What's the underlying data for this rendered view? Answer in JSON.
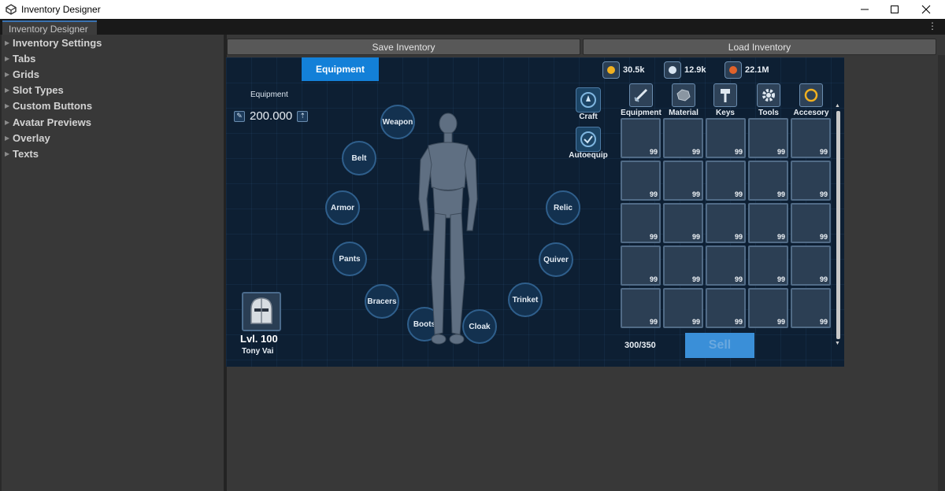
{
  "window": {
    "title": "Inventory Designer"
  },
  "editor": {
    "tab_label": "Inventory Designer",
    "menu_glyph": "⋮",
    "tree_items": [
      "Inventory Settings",
      "Tabs",
      "Grids",
      "Slot Types",
      "Custom Buttons",
      "Avatar Previews",
      "Overlay",
      "Texts"
    ],
    "save_label": "Save Inventory",
    "load_label": "Load Inventory"
  },
  "game": {
    "active_tab": "Equipment",
    "equipment_label": "Equipment",
    "weight_value": "200.000",
    "slots": {
      "weapon": "Weapon",
      "belt": "Belt",
      "armor": "Armor",
      "pants": "Pants",
      "bracers": "Bracers",
      "boots": "Boots",
      "cloak": "Cloak",
      "trinket": "Trinket",
      "quiver": "Quiver",
      "relic": "Relic"
    },
    "player": {
      "level": "Lvl. 100",
      "name": "Tony Vai"
    },
    "craft_label": "Craft",
    "autoequip_label": "Autoequip",
    "currencies": [
      {
        "amount": "30.5k",
        "color": "#f0b020"
      },
      {
        "amount": "12.9k",
        "color": "#d8e4f0"
      },
      {
        "amount": "22.1M",
        "color": "#e0622a"
      }
    ],
    "categories": [
      "Equipment",
      "Material",
      "Keys",
      "Tools",
      "Accesory"
    ],
    "cell_quantity": "99",
    "capacity": "300/350",
    "sell_label": "Sell"
  },
  "colors": {
    "accent": "#1380d8",
    "panel": "#0d1f33"
  }
}
